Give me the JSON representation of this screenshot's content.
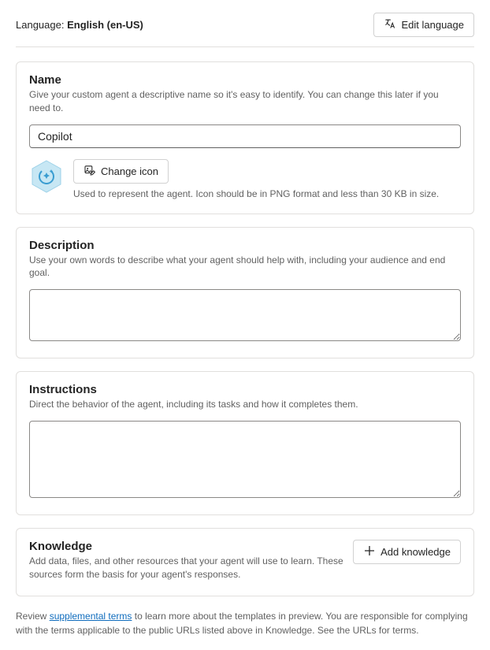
{
  "header": {
    "language_prefix": "Language: ",
    "language_value": "English (en-US)",
    "edit_language_label": "Edit language"
  },
  "name_section": {
    "title": "Name",
    "description": "Give your custom agent a descriptive name so it's easy to identify. You can change this later if you need to.",
    "value": "Copilot",
    "change_icon_label": "Change icon",
    "icon_help": "Used to represent the agent. Icon should be in PNG format and less than 30 KB in size."
  },
  "description_section": {
    "title": "Description",
    "description": "Use your own words to describe what your agent should help with, including your audience and end goal.",
    "value": ""
  },
  "instructions_section": {
    "title": "Instructions",
    "description": "Direct the behavior of the agent, including its tasks and how it completes them.",
    "value": ""
  },
  "knowledge_section": {
    "title": "Knowledge",
    "description": "Add data, files, and other resources that your agent will use to learn. These sources form the basis for your agent's responses.",
    "add_button_label": "Add knowledge"
  },
  "footer": {
    "pre": "Review ",
    "link": "supplemental terms",
    "post": " to learn more about the templates in preview. You are responsible for complying with the terms applicable to the public URLs listed above in Knowledge. See the URLs for terms."
  }
}
